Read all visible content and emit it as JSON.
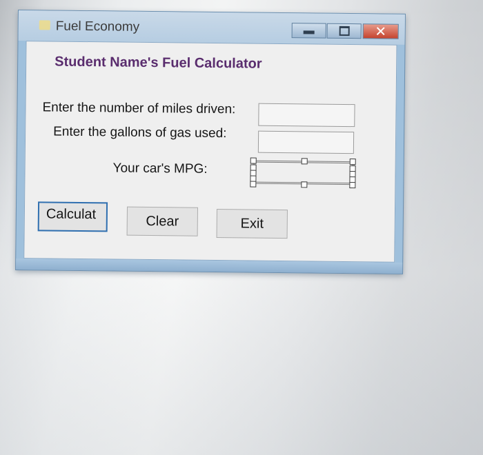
{
  "window": {
    "title": "Fuel Economy",
    "icon": "app-form-icon",
    "caption_buttons": {
      "minimize_icon": "minimize-icon",
      "maximize_icon": "maximize-icon",
      "close_icon": "close-icon",
      "close_glyph": "✕"
    },
    "accent_color": "#9fc0dc",
    "close_color": "#c5432e"
  },
  "form": {
    "heading": "Student Name's Fuel Calculator",
    "heading_color": "#5a2d6e",
    "miles_label": "Enter the number of miles driven:",
    "miles_value": "",
    "gallons_label": "Enter the gallons of gas used:",
    "gallons_value": "",
    "mpg_label": "Your car's MPG:",
    "mpg_value": ""
  },
  "buttons": {
    "calculate_label": "Calculat",
    "clear_label": "Clear",
    "exit_label": "Exit"
  }
}
